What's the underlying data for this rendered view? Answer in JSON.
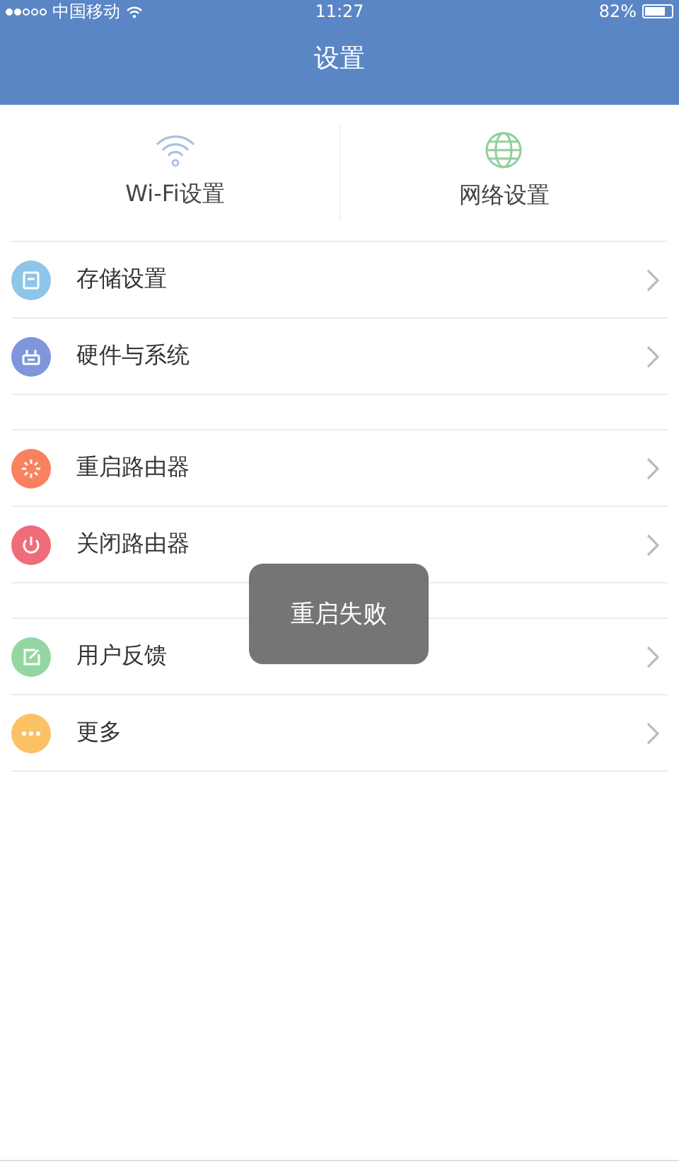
{
  "status_bar": {
    "carrier": "中国移动",
    "time": "11:27",
    "battery": "82%"
  },
  "header": {
    "title": "设置"
  },
  "shortcuts": [
    {
      "kind": "wifi",
      "label": "Wi-Fi设置"
    },
    {
      "kind": "globe",
      "label": "网络设置"
    }
  ],
  "groups": [
    [
      {
        "kind": "storage",
        "label": "存储设置",
        "color": "#8ec5e8"
      },
      {
        "kind": "hardware",
        "label": "硬件与系统",
        "color": "#7f95dc"
      }
    ],
    [
      {
        "kind": "restart",
        "label": "重启路由器",
        "color": "#f98160"
      },
      {
        "kind": "power",
        "label": "关闭路由器",
        "color": "#ef6d78"
      }
    ],
    [
      {
        "kind": "feedback",
        "label": "用户反馈",
        "color": "#94d6a2"
      },
      {
        "kind": "more",
        "label": "更多",
        "color": "#fbc265"
      }
    ]
  ],
  "toast": {
    "message": "重启失败"
  }
}
